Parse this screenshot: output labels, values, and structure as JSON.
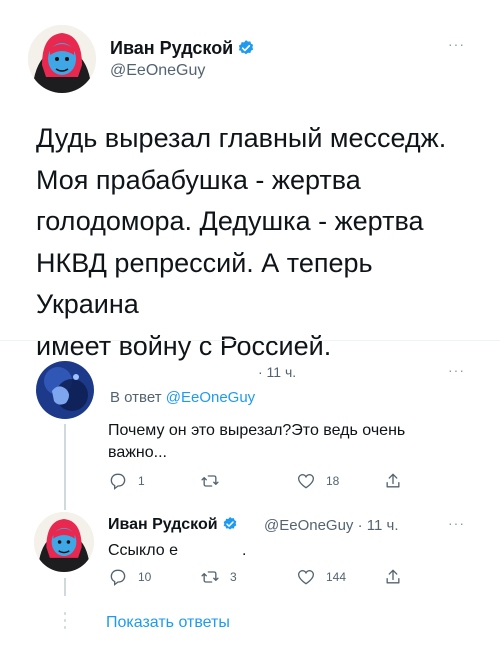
{
  "tweet": {
    "author_name": "Иван Рудской",
    "author_handle": "@EeOneGuy",
    "text": "Дудь вырезал главный месседж.\nМоя прабабушка - жертва\nголодомора. Дедушка - жертва\nНКВД репрессий. А теперь Украина\nимеет войну с Россией.",
    "more_icon": "more-dots-icon"
  },
  "reply1": {
    "time": "· 11 ч.",
    "in_reply_prefix": "В ответ",
    "in_reply_handle": "@EeOneGuy",
    "text": "Почему он это вырезал?Это ведь очень важно...",
    "actions": {
      "reply_count": "1",
      "retweet_count": "",
      "like_count": "18"
    }
  },
  "reply2": {
    "author_name": "Иван Рудской",
    "author_handle": "@EeOneGuy",
    "time": "· 11 ч.",
    "text": "Ссыкло е",
    "text_after": ".",
    "actions": {
      "reply_count": "10",
      "retweet_count": "3",
      "like_count": "144"
    }
  },
  "show_replies_label": "Показать ответы",
  "colors": {
    "link": "#1d9bf0",
    "muted": "#536471",
    "verified": "#1d9bf0",
    "avatar_hood": "#e8284f",
    "avatar_face": "#3fa7e6"
  }
}
